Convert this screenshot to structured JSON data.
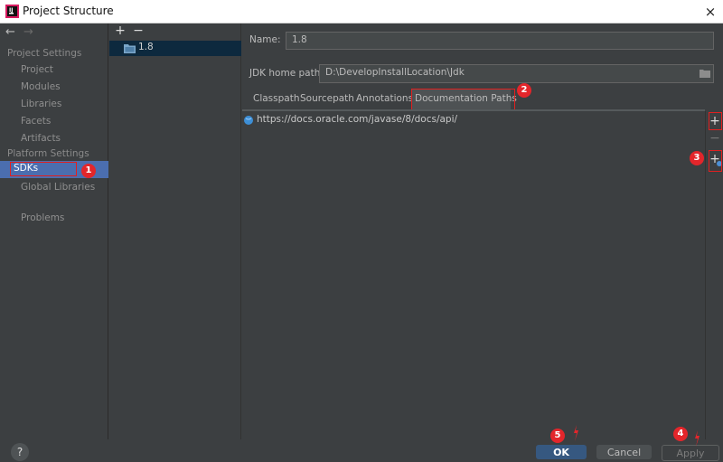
{
  "window": {
    "title": "Project Structure",
    "close_symbol": "×"
  },
  "nav": {
    "back_symbol": "←",
    "forward_symbol": "→",
    "project_settings_header": "Project Settings",
    "project_items": [
      "Project",
      "Modules",
      "Libraries",
      "Facets",
      "Artifacts"
    ],
    "platform_settings_header": "Platform Settings",
    "sdks": "SDKs",
    "global_libraries": "Global Libraries",
    "problems": "Problems"
  },
  "sdk_list": {
    "add_symbol": "+",
    "remove_symbol": "−",
    "items": [
      "1.8"
    ]
  },
  "sdk_detail": {
    "name_label": "Name:",
    "name_value": "1.8",
    "home_label": "JDK home path:",
    "home_value": "D:\\DevelopInstallLocation\\Jdk",
    "tabs": [
      "Classpath",
      "Sourcepath",
      "Annotations",
      "Documentation Paths"
    ],
    "active_tab": "Documentation Paths",
    "doc_paths": [
      "https://docs.oracle.com/javase/8/docs/api/"
    ],
    "add_symbol": "+",
    "specify_url_symbol": "+",
    "remove_symbol": "−"
  },
  "footer": {
    "help_symbol": "?",
    "ok_label": "OK",
    "cancel_label": "Cancel",
    "apply_label": "Apply"
  },
  "annotations": [
    "1",
    "2",
    "3",
    "4",
    "5"
  ],
  "colors": {
    "selection": "#4b6eaf",
    "annotation_red": "#e3262b",
    "background": "#3c3f41"
  }
}
